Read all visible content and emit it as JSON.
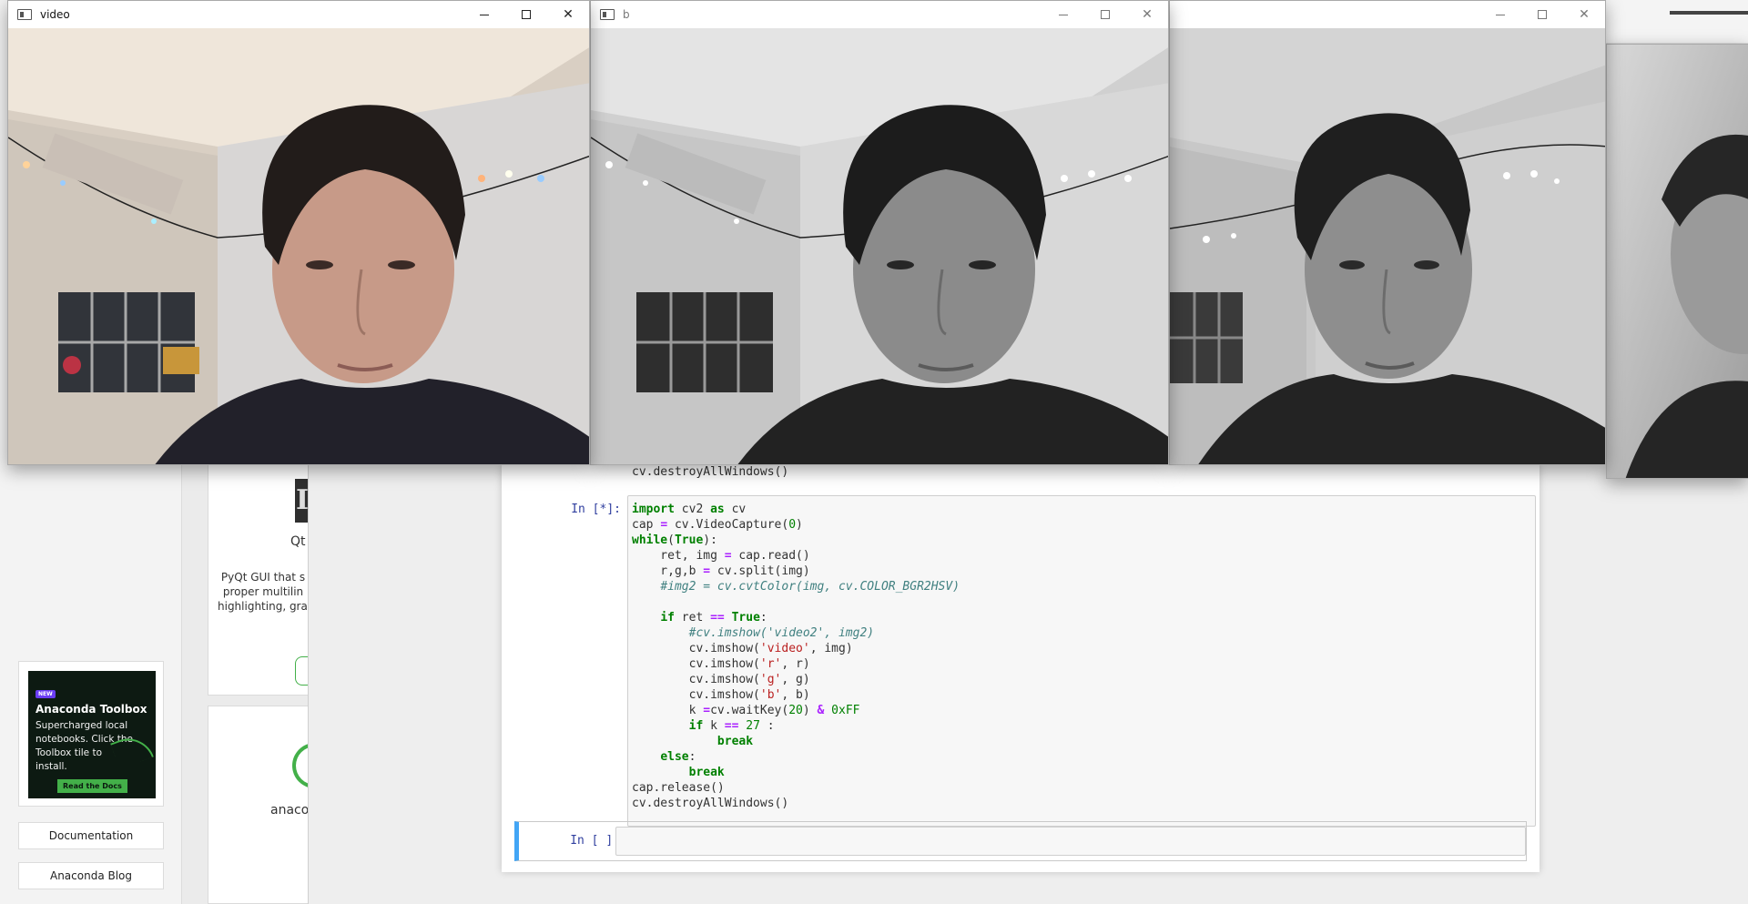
{
  "navigator": {
    "qt_card": {
      "title": "Qt",
      "desc_lines": [
        "PyQt GUI that s",
        "proper multilin",
        "highlighting, grap"
      ]
    },
    "anaconda_card": {
      "title": "anacon"
    },
    "promo": {
      "badge": "NEW",
      "title": "Anaconda Toolbox",
      "text": "Supercharged local notebooks. Click the Toolbox tile to install.",
      "cta": "Read the Docs"
    },
    "links": {
      "documentation": "Documentation",
      "blog": "Anaconda Blog"
    }
  },
  "notebook": {
    "prev_cell_line": "cv.destroyAllWindows()",
    "running_prompt": "In [*]:",
    "empty_prompt": "In [ ]:"
  },
  "windows": {
    "video": {
      "title": "video"
    },
    "b": {
      "title": "b"
    },
    "g": {
      "title": ""
    }
  },
  "colors": {
    "anaconda_green": "#43b049",
    "jupyter_prompt_blue": "#303f9f",
    "selected_cell_blue": "#42a5f5"
  }
}
